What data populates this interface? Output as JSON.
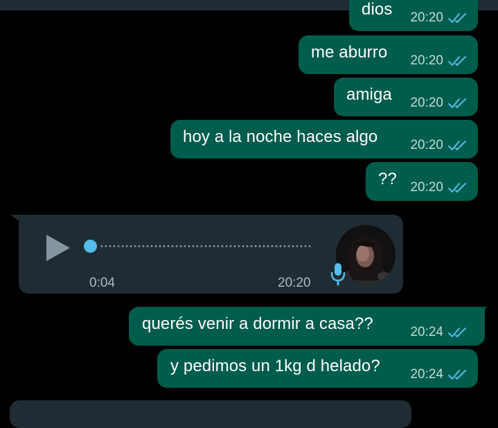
{
  "colors": {
    "outgoing_bubble": "#005c4b",
    "incoming_bubble": "#1f2c33",
    "read_ticks": "#53bdeb",
    "background": "#000000"
  },
  "messages_top": [
    {
      "text": "dios",
      "time": "20:20",
      "status": "read-ticks-icon"
    },
    {
      "text": "me aburro",
      "time": "20:20",
      "status": "read-ticks-icon"
    },
    {
      "text": "amiga",
      "time": "20:20",
      "status": "read-ticks-icon"
    },
    {
      "text": "hoy a la noche haces algo",
      "time": "20:20",
      "status": "read-ticks-icon"
    },
    {
      "text": "??",
      "time": "20:20",
      "status": "read-ticks-icon"
    }
  ],
  "voice_message": {
    "duration": "0:04",
    "time": "20:20",
    "progress": 0,
    "icons": [
      "play-icon",
      "avatar",
      "mic-icon"
    ]
  },
  "messages_bottom": [
    {
      "text": "querés venir a dormir a casa??",
      "time": "20:24",
      "status": "read-ticks-icon"
    },
    {
      "text": "y pedimos un 1kg d helado?",
      "time": "20:24",
      "status": "read-ticks-icon"
    }
  ]
}
